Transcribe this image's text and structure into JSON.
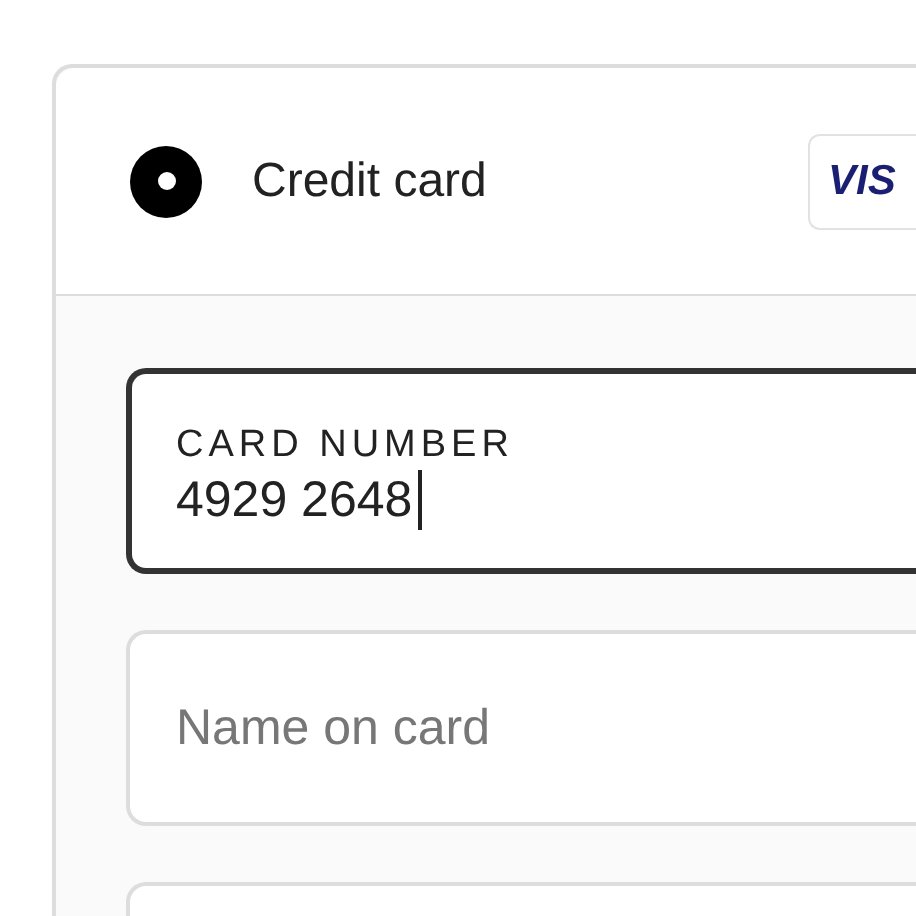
{
  "payment_method": {
    "label": "Credit card",
    "selected": true,
    "card_logo": "VIS"
  },
  "fields": [
    {
      "kind": "filled",
      "label": "CARD NUMBER",
      "value": "4929 2648",
      "focused": true
    },
    {
      "kind": "empty",
      "placeholder": "Name on card",
      "focused": false
    },
    {
      "kind": "blank",
      "focused": false
    }
  ]
}
